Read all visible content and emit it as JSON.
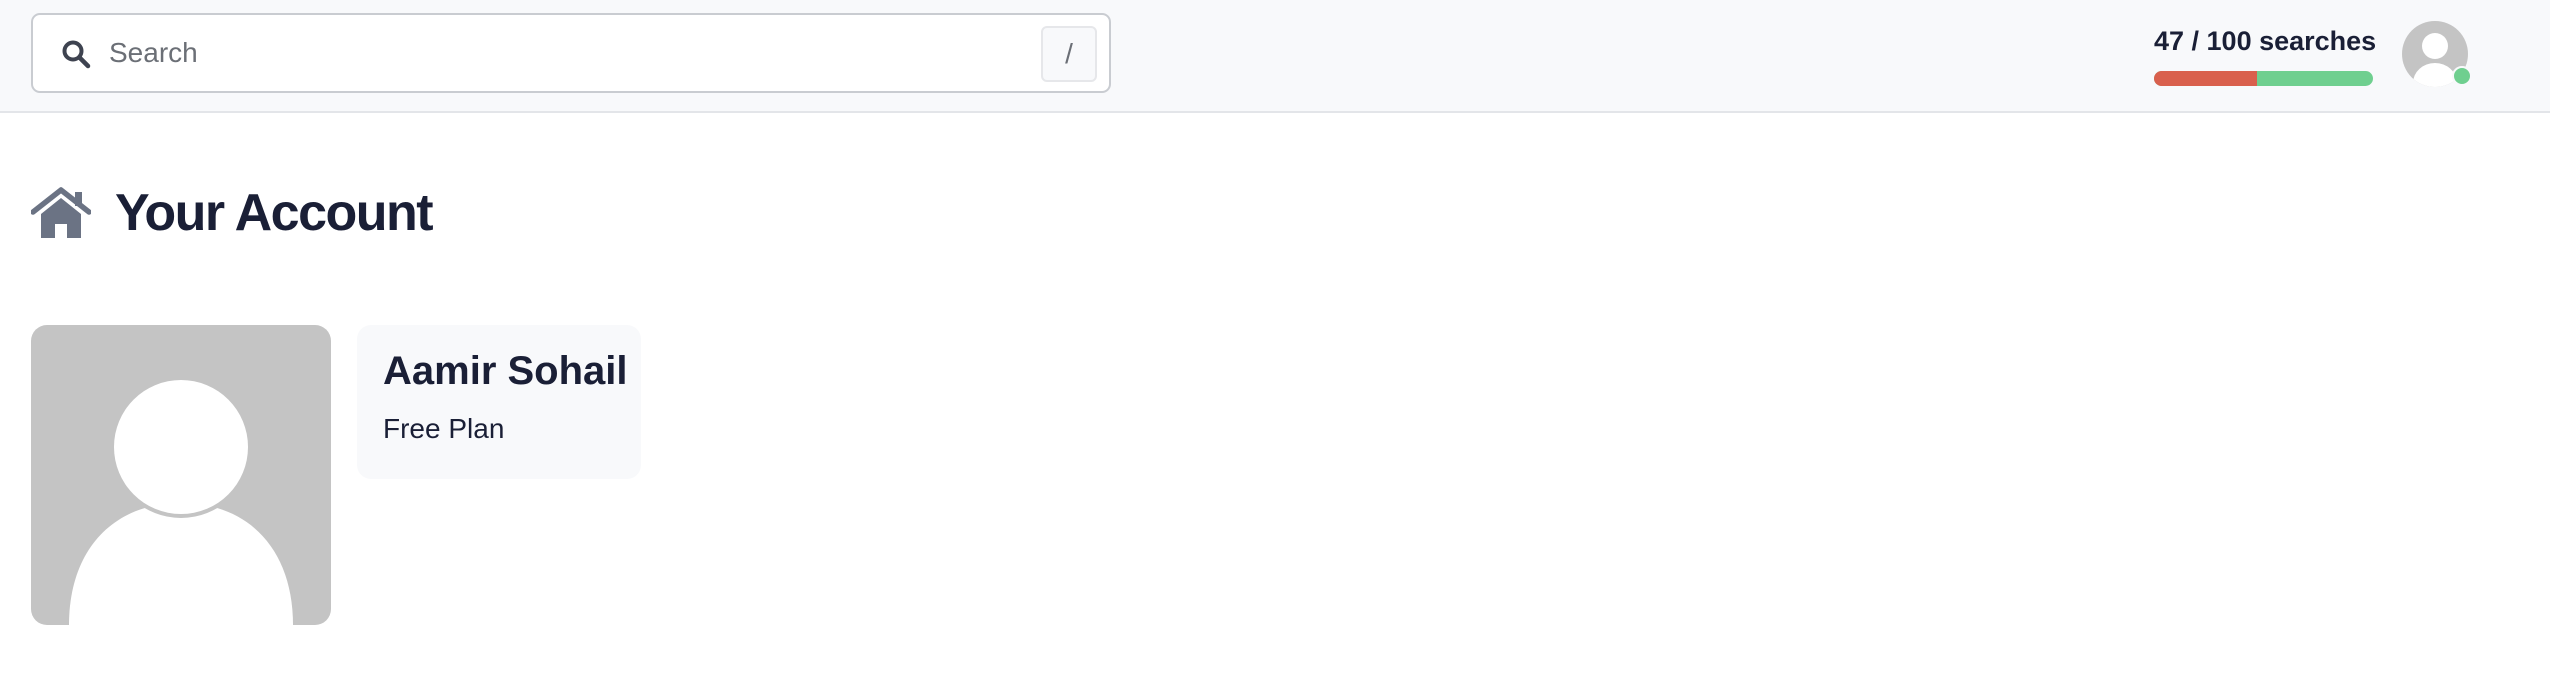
{
  "header": {
    "search": {
      "placeholder": "Search",
      "value": "",
      "shortcut_hint": "/"
    },
    "usage": {
      "label": "47 / 100 searches",
      "used": 47,
      "limit": 100,
      "used_color": "#d9604d",
      "remaining_color": "#6fcf8f"
    },
    "user_menu": {
      "status": "online",
      "status_color": "#6fcf8f"
    }
  },
  "page": {
    "icon": "home-icon",
    "title": "Your Account"
  },
  "profile": {
    "photo_icon": "default-avatar",
    "name": "Aamir Sohail",
    "plan": "Free Plan"
  }
}
